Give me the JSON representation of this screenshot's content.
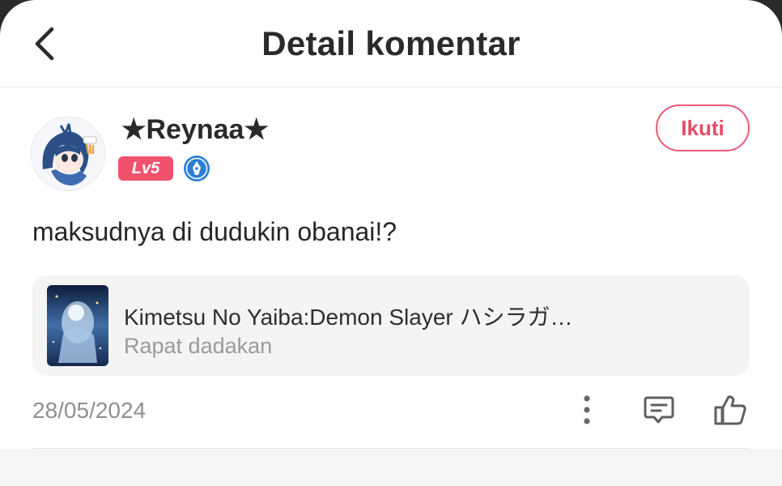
{
  "header": {
    "title": "Detail komentar"
  },
  "user": {
    "name": "★Reynaa★",
    "level": "Lv5",
    "follow_label": "Ikuti"
  },
  "comment": {
    "text": "maksudnya di dudukin obanai!?"
  },
  "linked_story": {
    "title": "Kimetsu No Yaiba:Demon Slayer ハシラガ…",
    "chapter": "Rapat dadakan"
  },
  "meta": {
    "date": "28/05/2024"
  },
  "colors": {
    "accent": "#ea5b73",
    "level_badge": "#f0526d",
    "creator_badge": "#2d7fd6"
  },
  "icons": [
    "back-icon",
    "more-icon",
    "reply-icon",
    "like-icon"
  ]
}
